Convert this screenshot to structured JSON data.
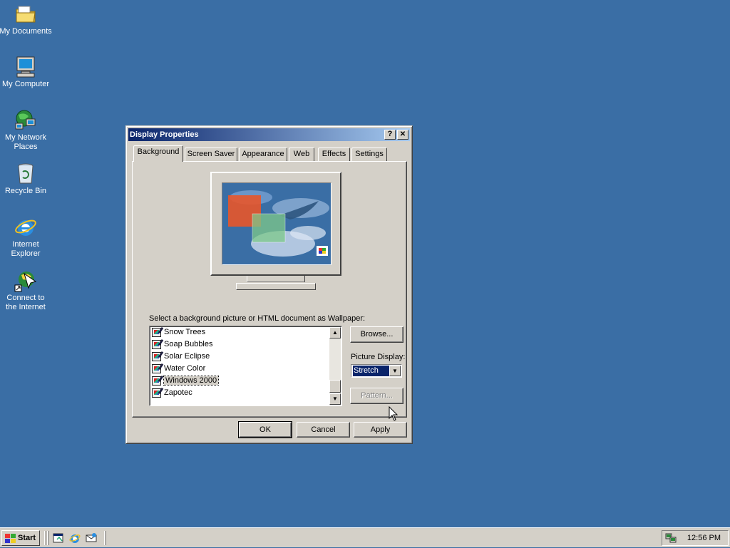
{
  "desktop": {
    "icons": [
      {
        "label": "My Documents",
        "icon": "folder-icon"
      },
      {
        "label": "My Computer",
        "icon": "computer-icon"
      },
      {
        "label": "My Network Places",
        "icon": "network-icon"
      },
      {
        "label": "Recycle Bin",
        "icon": "recycle-bin-icon"
      },
      {
        "label": "Internet Explorer",
        "icon": "internet-explorer-icon"
      },
      {
        "label": "Connect to the Internet",
        "icon": "connect-internet-icon"
      }
    ]
  },
  "window": {
    "title": "Display Properties",
    "help_button": "?",
    "close_button": "✕",
    "tabs": [
      {
        "label": "Background",
        "active": true
      },
      {
        "label": "Screen Saver",
        "active": false
      },
      {
        "label": "Appearance",
        "active": false
      },
      {
        "label": "Web",
        "active": false
      },
      {
        "label": "Effects",
        "active": false
      },
      {
        "label": "Settings",
        "active": false
      }
    ],
    "wallpaper_prompt": "Select a background picture or HTML document as Wallpaper:",
    "wallpaper_list": {
      "items": [
        "Snow Trees",
        "Soap Bubbles",
        "Solar Eclipse",
        "Water Color",
        "Windows 2000",
        "Zapotec"
      ],
      "selected": "Windows 2000"
    },
    "browse_button": "Browse...",
    "picture_display_label": "Picture Display:",
    "picture_display_value": "Stretch",
    "pattern_button": "Pattern...",
    "ok_button": "OK",
    "cancel_button": "Cancel",
    "apply_button": "Apply"
  },
  "taskbar": {
    "start_label": "Start",
    "quick_launch": [
      "show-desktop-icon",
      "internet-explorer-icon",
      "outlook-express-icon"
    ],
    "tray_icons": [
      "network-tray-icon"
    ],
    "clock": "12:56 PM"
  },
  "colors": {
    "desktop": "#3a6ea5",
    "face": "#d4d0c8",
    "title_start": "#0a246a",
    "title_end": "#a6caf0"
  }
}
